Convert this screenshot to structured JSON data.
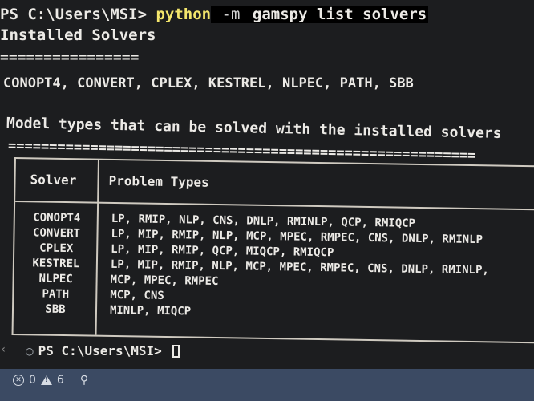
{
  "terminal": {
    "command_line": {
      "prompt": "PS C:\\Users\\MSI> ",
      "executable": "python",
      "flag": " -m",
      "args": " gamspy list solvers"
    },
    "installed_header": "Installed Solvers",
    "installed_separator": "================",
    "installed_list": "CONOPT4, CONVERT, CPLEX, KESTREL, NLPEC, PATH, SBB",
    "model_types_header": "Model types that can be solved with the installed solvers",
    "model_types_separator": "=========================================================",
    "table": {
      "headers": {
        "solver": "Solver",
        "problem_types": "Problem Types"
      },
      "rows": [
        {
          "solver": "CONOPT4",
          "types": "LP, RMIP, NLP, CNS, DNLP, RMINLP, QCP, RMIQCP"
        },
        {
          "solver": "CONVERT",
          "types": "LP, MIP, RMIP, NLP, MCP, MPEC, RMPEC, CNS, DNLP, RMINLP"
        },
        {
          "solver": "CPLEX",
          "types": "LP, MIP, RMIP, QCP, MIQCP, RMIQCP"
        },
        {
          "solver": "KESTREL",
          "types": "LP, MIP, RMIP, NLP, MCP, MPEC, RMPEC, CNS, DNLP, RMINLP,"
        },
        {
          "solver": "NLPEC",
          "types": "MCP, MPEC, RMPEC"
        },
        {
          "solver": "PATH",
          "types": "MCP, CNS"
        },
        {
          "solver": "SBB",
          "types": "MINLP, MIQCP"
        }
      ]
    },
    "prompt_final": "PS C:\\Users\\MSI> "
  },
  "statusbar": {
    "errors": "0",
    "warnings": "6"
  },
  "colors": {
    "background": "#1c1d1f",
    "command_accent": "#f4e66c",
    "statusbar": "#3b4a63"
  },
  "icons": [
    "error-icon",
    "warning-icon",
    "broadcast-icon",
    "prompt-circle-icon",
    "cursor-icon"
  ]
}
